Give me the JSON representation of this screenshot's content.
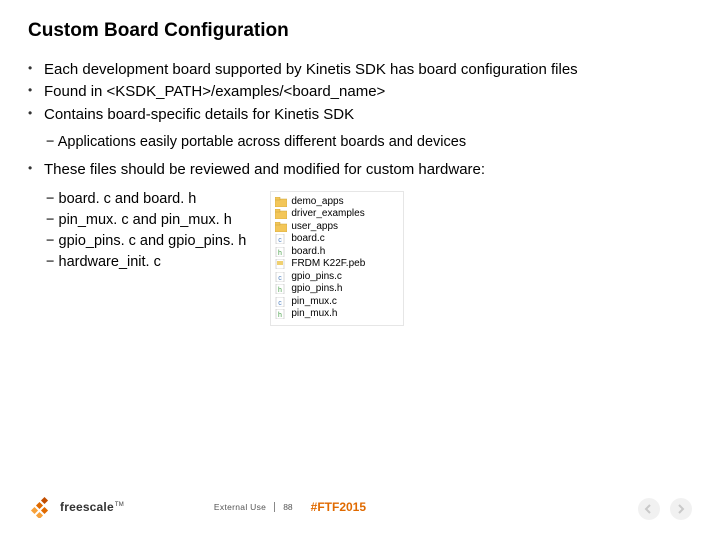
{
  "title": "Custom Board Configuration",
  "bullets": {
    "b1": "Each development board supported by Kinetis SDK has board configuration files",
    "b2": "Found in <KSDK_PATH>/examples/<board_name>",
    "b3": "Contains board-specific details for Kinetis SDK",
    "sub_portable": "Applications easily portable across different boards and devices",
    "b4": "These files should be reviewed and modified for custom hardware:"
  },
  "file_sub": {
    "f1": "board. c and board. h",
    "f2": "pin_mux. c and pin_mux. h",
    "f3": "gpio_pins. c and gpio_pins. h",
    "f4": "hardware_init. c"
  },
  "listing": {
    "r1": "demo_apps",
    "r2": "driver_examples",
    "r3": "user_apps",
    "r4": "board.c",
    "r5": "board.h",
    "r6": "FRDM K22F.peb",
    "r7": "gpio_pins.c",
    "r8": "gpio_pins.h",
    "r9": "pin_mux.c",
    "r10": "pin_mux.h"
  },
  "footer": {
    "logo_text": "freescale",
    "tm": "TM",
    "external_use": "External Use",
    "page": "88",
    "hashtag": "#FTF2015"
  }
}
